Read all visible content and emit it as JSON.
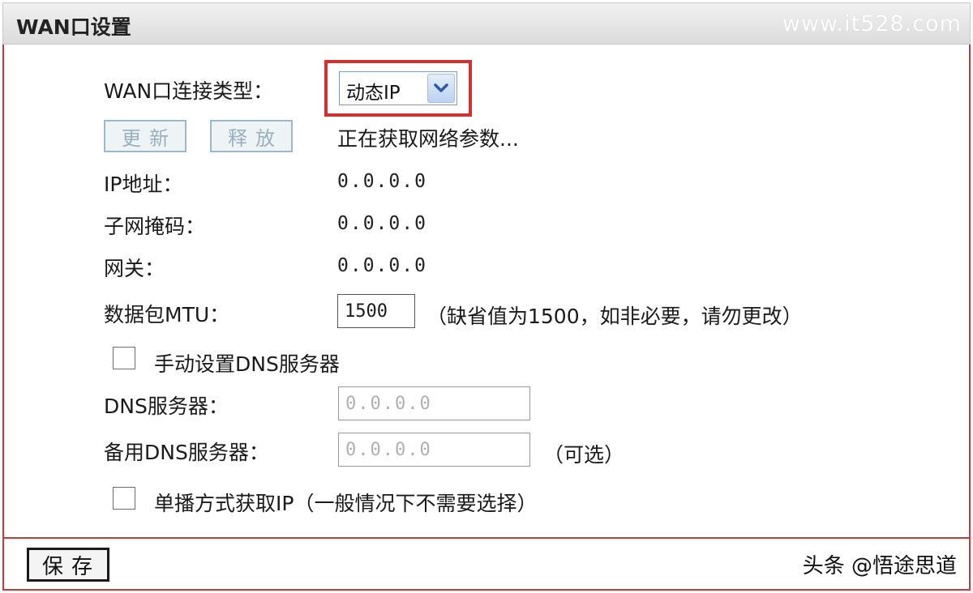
{
  "title_bar": {
    "title": "WAN口设置",
    "watermark": "www.it528.com"
  },
  "form": {
    "wan_type_label": "WAN口连接类型：",
    "wan_type_value": "动态IP",
    "renew_button": "更新",
    "release_button": "释放",
    "status_text": "正在获取网络参数...",
    "ip_label": "IP地址：",
    "ip_value": "0.0.0.0",
    "mask_label": "子网掩码：",
    "mask_value": "0.0.0.0",
    "gateway_label": "网关：",
    "gateway_value": "0.0.0.0",
    "mtu_label": "数据包MTU：",
    "mtu_value": "1500",
    "mtu_hint": "（缺省值为1500，如非必要，请勿更改）",
    "manual_dns_label": "手动设置DNS服务器",
    "dns_label": "DNS服务器：",
    "dns_value": "0.0.0.0",
    "alt_dns_label": "备用DNS服务器：",
    "alt_dns_value": "0.0.0.0",
    "alt_dns_hint": "（可选）",
    "unicast_label": "单播方式获取IP（一般情况下不需要选择）"
  },
  "footer": {
    "save_button": "保存",
    "watermark": "头条 @悟途思道"
  },
  "colors": {
    "highlight": "#d03030",
    "border": "#c43a3a",
    "dropdown_arrow": "#2b5aa8"
  },
  "icons": {
    "dropdown": "chevron-down-icon"
  }
}
